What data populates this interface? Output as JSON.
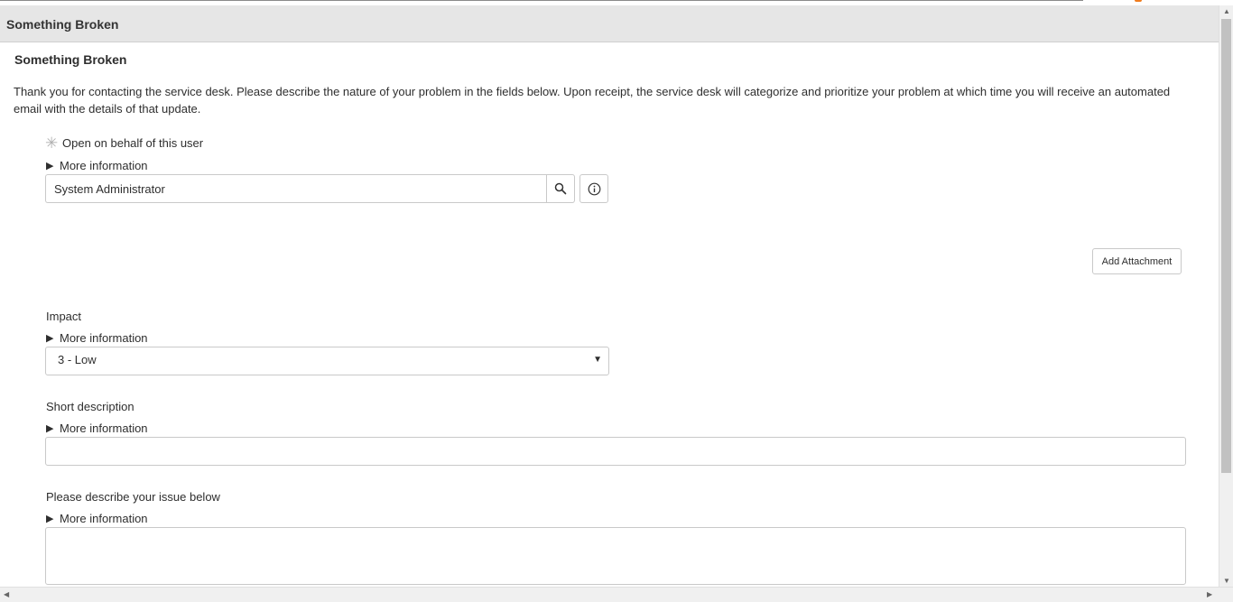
{
  "header": {
    "title": "Something Broken"
  },
  "form": {
    "title": "Something Broken",
    "description": "Thank you for contacting the service desk. Please describe the nature of your problem in the fields below. Upon receipt, the service desk will categorize and prioritize your problem at which time you will receive an automated email with the details of that update."
  },
  "fields": {
    "behalf": {
      "label": "Open on behalf of this user",
      "more_info": "More information",
      "value": "System Administrator",
      "required_icon": "asterisk-icon",
      "search_icon": "search-icon",
      "info_icon": "info-icon"
    },
    "attachment": {
      "label": "Add Attachment"
    },
    "impact": {
      "label": "Impact",
      "more_info": "More information",
      "selected": "3 - Low"
    },
    "short_description": {
      "label": "Short description",
      "more_info": "More information",
      "value": ""
    },
    "issue": {
      "label": "Please describe your issue below",
      "more_info": "More information",
      "value": ""
    }
  },
  "colors": {
    "header_bg": "#e6e6e6",
    "border": "#c9c9c9",
    "text": "#2e2e2e",
    "required": "#b0b0b0"
  }
}
